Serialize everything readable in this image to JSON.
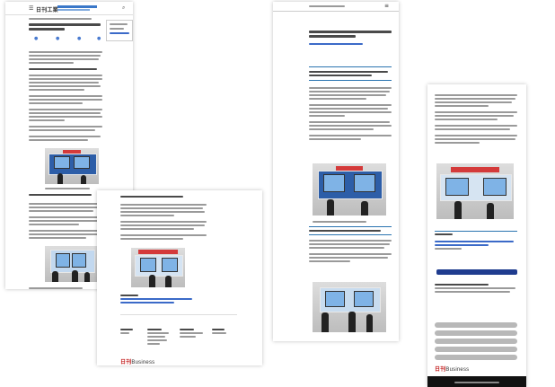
{
  "site": {
    "logo_text": "日刊工業",
    "footer_logo_red": "日刊",
    "footer_logo_rest": "Business"
  },
  "colors": {
    "nav_blue": "#3a77c8",
    "accent_red": "#c21d1d",
    "button_blue": "#1f3c8f",
    "rule_blue": "#2a74b0"
  },
  "icons": {
    "menu": "hamburger-icon",
    "search": "search-icon",
    "share": "share-icon"
  }
}
